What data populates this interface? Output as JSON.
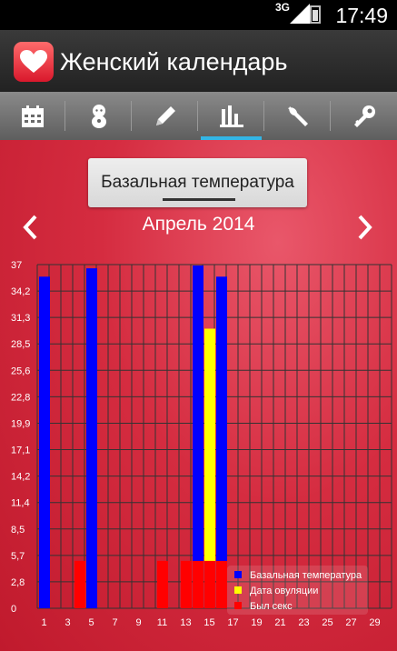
{
  "status_bar": {
    "network": "3G",
    "time": "17:49"
  },
  "app": {
    "title": "Женский календарь"
  },
  "tabs": [
    {
      "name": "tab-calendar",
      "icon": "calendar-icon",
      "active": false
    },
    {
      "name": "tab-baby",
      "icon": "baby-icon",
      "active": false
    },
    {
      "name": "tab-notes",
      "icon": "pencil-icon",
      "active": false
    },
    {
      "name": "tab-charts",
      "icon": "bar-chart-icon",
      "active": true
    },
    {
      "name": "tab-settings",
      "icon": "wrench-icon",
      "active": false
    },
    {
      "name": "tab-password",
      "icon": "key-icon",
      "active": false
    }
  ],
  "chart_selector": {
    "value": "Базальная температура"
  },
  "month_nav": {
    "label": "Апрель 2014"
  },
  "colors": {
    "blue": "#0000ff",
    "yellow": "#ffff00",
    "red": "#ff0000",
    "grid": "#333333"
  },
  "chart_data": {
    "type": "bar",
    "y_ticks": [
      "37",
      "34,2",
      "31,3",
      "28,5",
      "25,6",
      "22,8",
      "19,9",
      "17,1",
      "14,2",
      "11,4",
      "8,5",
      "5,7",
      "2,8",
      "0"
    ],
    "ylim": [
      0,
      37
    ],
    "x_ticks": [
      "1",
      "3",
      "5",
      "7",
      "9",
      "11",
      "13",
      "15",
      "17",
      "19",
      "21",
      "23",
      "25",
      "27",
      "29"
    ],
    "days": 30,
    "series": [
      {
        "name": "Базальная температура",
        "color": "#0000ff",
        "points": [
          {
            "day": 1,
            "value": 35.7
          },
          {
            "day": 5,
            "value": 36.6
          },
          {
            "day": 14,
            "value": 36.9
          },
          {
            "day": 16,
            "value": 35.7
          }
        ]
      },
      {
        "name": "Дата овуляции",
        "color": "#ffff00",
        "points": [
          {
            "day": 15,
            "value": 30.1
          }
        ]
      },
      {
        "name": "Был секс",
        "color": "#ff0000",
        "points": [
          {
            "day": 4,
            "value": 5.1
          },
          {
            "day": 11,
            "value": 5.1
          },
          {
            "day": 13,
            "value": 5.1
          },
          {
            "day": 14,
            "value": 5.1
          },
          {
            "day": 15,
            "value": 5.1
          },
          {
            "day": 16,
            "value": 5.1
          }
        ]
      }
    ],
    "legend_position": "bottom-right"
  }
}
